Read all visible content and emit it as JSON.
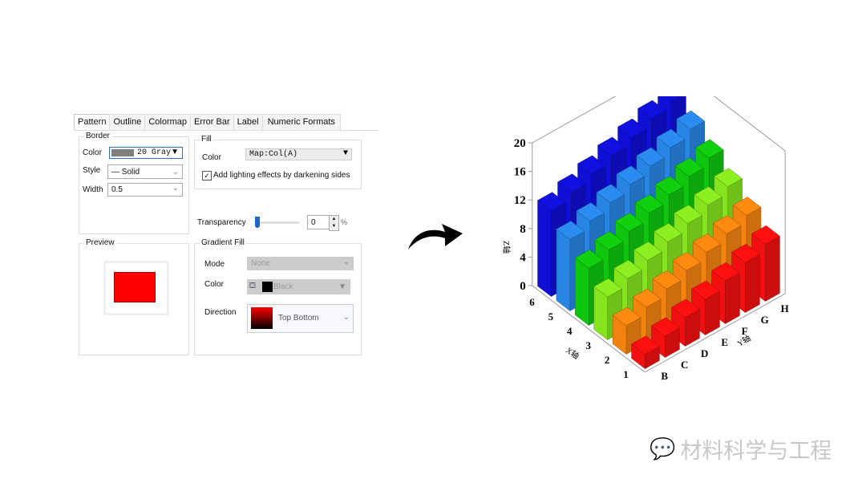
{
  "dialog": {
    "tabs": [
      "Pattern",
      "Outline",
      "Colormap",
      "Error Bar",
      "Label",
      "Numeric Formats"
    ],
    "active_tab": "Pattern",
    "border": {
      "title": "Border",
      "color_label": "Color",
      "color_value": "20 Gray",
      "style_label": "Style",
      "style_value": "— Solid",
      "width_label": "Width",
      "width_value": "0.5"
    },
    "fill": {
      "title": "Fill",
      "color_label": "Color",
      "color_value": "Map:Col(A)",
      "lighting_label": "Add lighting effects by darkening sides",
      "lighting_checked": true
    },
    "transparency": {
      "label": "Transparency",
      "value": "0",
      "unit": "%",
      "level": 0
    },
    "preview": {
      "title": "Preview",
      "swatch_color": "#ff0000"
    },
    "gradient": {
      "title": "Gradient Fill",
      "mode_label": "Mode",
      "mode_value": "None",
      "color_label": "Color",
      "color_value": "Black",
      "direction_label": "Direction",
      "direction_value": "Top Bottom"
    }
  },
  "chart_data": {
    "type": "bar3d",
    "x_categories": [
      1,
      2,
      3,
      4,
      5,
      6
    ],
    "y_categories": [
      "B",
      "C",
      "D",
      "E",
      "F",
      "G",
      "H"
    ],
    "z_ticks": [
      0,
      4,
      8,
      12,
      16,
      20
    ],
    "zlim": [
      0,
      20
    ],
    "xlabel": "X轴",
    "ylabel": "Y轴",
    "zlabel": "Z轴",
    "row_colors": [
      "#ff1010",
      "#ff8a10",
      "#8cf020",
      "#10d010",
      "#2a8cf0",
      "#1010e0"
    ],
    "values": [
      [
        2,
        3,
        4,
        5,
        6,
        7,
        8
      ],
      [
        4,
        5,
        6,
        7,
        8,
        9,
        10
      ],
      [
        6,
        7,
        8,
        9,
        10,
        11,
        12
      ],
      [
        8,
        9,
        10,
        11,
        12,
        13,
        14
      ],
      [
        10,
        11,
        12,
        13,
        14,
        15,
        16
      ],
      [
        12,
        13,
        14,
        15,
        16,
        17,
        18
      ]
    ]
  },
  "watermark": {
    "text": "材料科学与工程"
  }
}
